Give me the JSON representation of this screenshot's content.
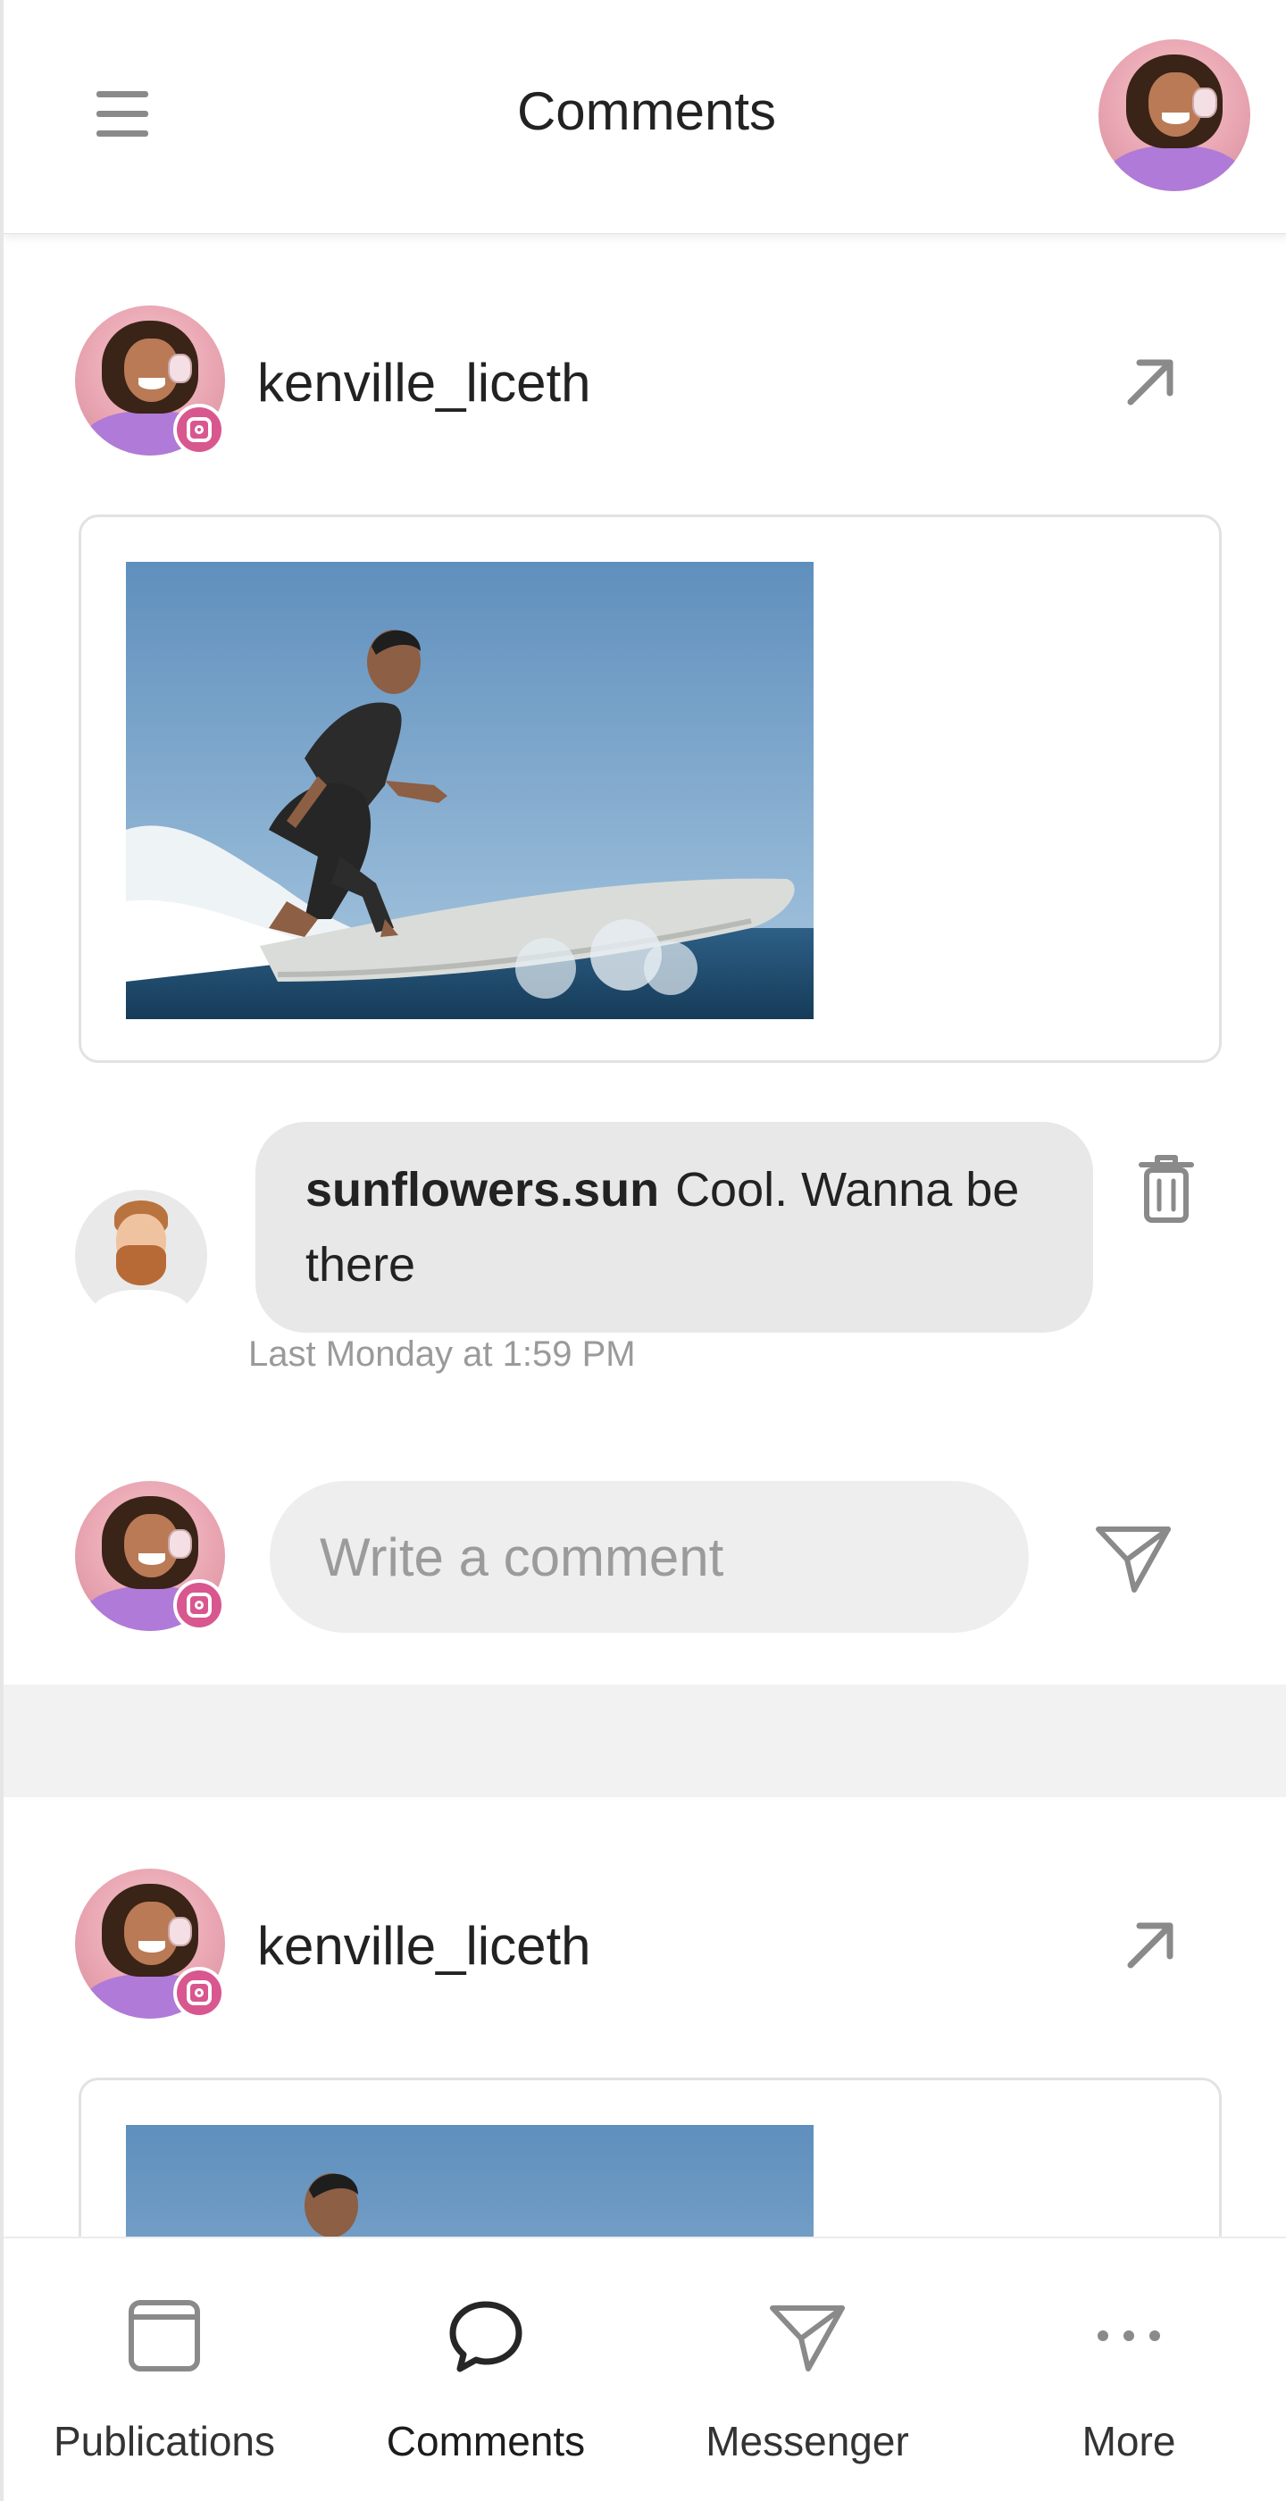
{
  "header": {
    "title": "Comments",
    "menu_icon": "hamburger-icon",
    "avatar_icon": "user-avatar"
  },
  "posts": [
    {
      "author": "kenville_liceth",
      "platform_icon": "instagram-icon",
      "open_icon": "arrow-up-right-icon",
      "media": "surfer-photo",
      "comments": [
        {
          "author": "sunflowers.sun",
          "text": "Cool. Wanna be there",
          "time": "Last Monday at 1:59 PM",
          "delete_icon": "trash-icon"
        }
      ],
      "compose": {
        "placeholder": "Write a comment",
        "send_icon": "send-icon"
      }
    },
    {
      "author": "kenville_liceth",
      "platform_icon": "instagram-icon",
      "open_icon": "arrow-up-right-icon",
      "media": "surfer-photo"
    }
  ],
  "bottom_nav": {
    "items": [
      {
        "label": "Publications",
        "icon": "window-icon",
        "active": false
      },
      {
        "label": "Comments",
        "icon": "speech-bubble-icon",
        "active": true
      },
      {
        "label": "Messenger",
        "icon": "paper-plane-icon",
        "active": false
      },
      {
        "label": "More",
        "icon": "ellipsis-icon",
        "active": false
      }
    ]
  },
  "colors": {
    "background": "#f2f2f2",
    "card": "#ffffff",
    "bubble": "#e8e8e8",
    "input": "#eeeeee",
    "icon_gray": "#8a8a8a",
    "instagram_badge": "#d8578f",
    "muted_text": "#9a9a9a"
  }
}
